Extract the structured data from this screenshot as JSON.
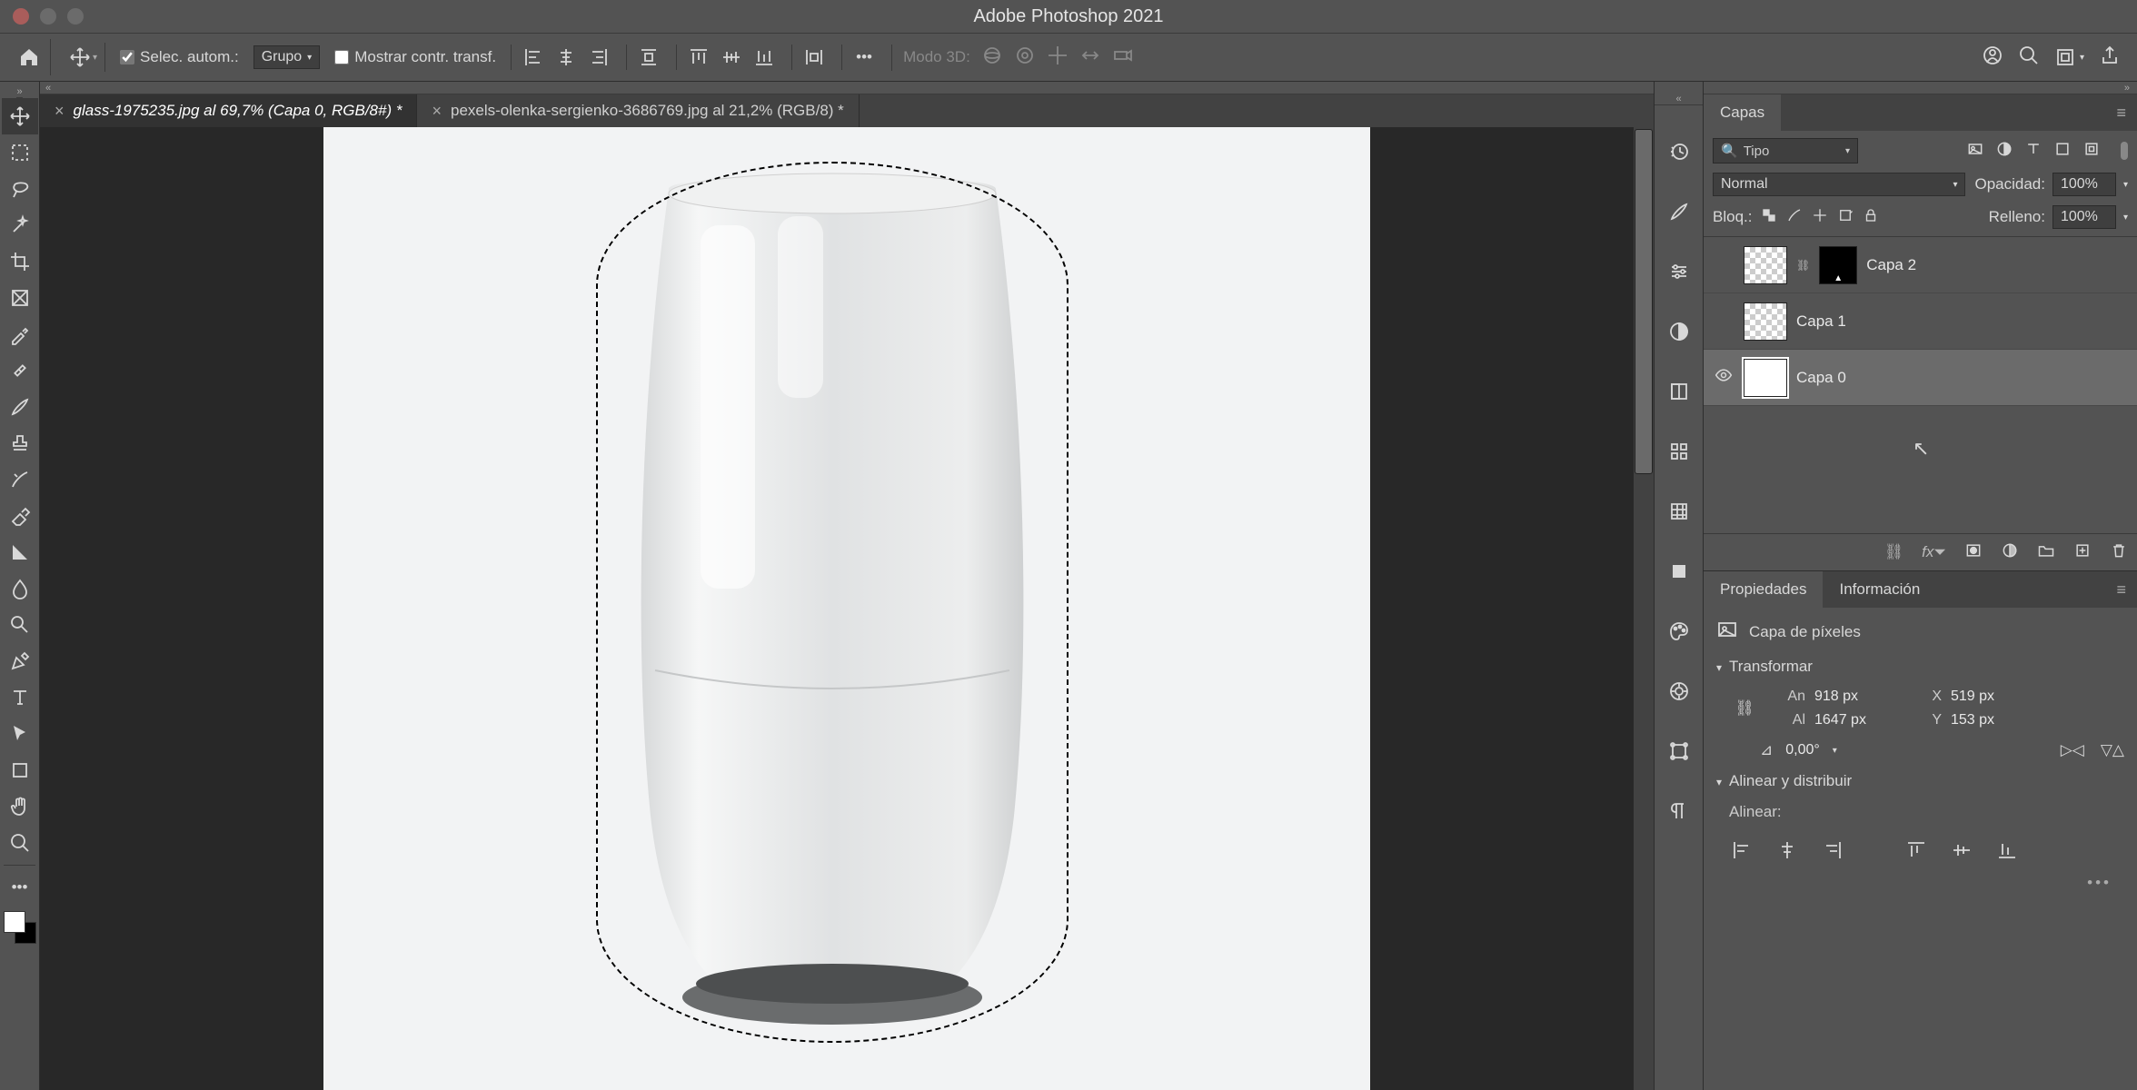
{
  "app_title": "Adobe Photoshop 2021",
  "options": {
    "auto_select_label": "Selec. autom.:",
    "group_select": "Grupo",
    "show_transform_label": "Mostrar contr. transf.",
    "mode3d_label": "Modo 3D:"
  },
  "tabs": [
    {
      "title": "glass-1975235.jpg al 69,7% (Capa 0, RGB/8#) *",
      "active": true
    },
    {
      "title": "pexels-olenka-sergienko-3686769.jpg al 21,2% (RGB/8) *",
      "active": false
    }
  ],
  "panels": {
    "layers_tab": "Capas",
    "filter_label": "Tipo",
    "blend_mode": "Normal",
    "opacity_label": "Opacidad:",
    "opacity_value": "100%",
    "lock_label": "Bloq.:",
    "fill_label": "Relleno:",
    "fill_value": "100%",
    "layers": [
      {
        "name": "Capa 2",
        "visible": false,
        "has_mask": true,
        "selected": false
      },
      {
        "name": "Capa 1",
        "visible": false,
        "has_mask": false,
        "selected": false
      },
      {
        "name": "Capa 0",
        "visible": true,
        "has_mask": false,
        "selected": true
      }
    ],
    "properties_tab": "Propiedades",
    "info_tab": "Información",
    "pixel_layer_label": "Capa de píxeles",
    "transform_label": "Transformar",
    "transform": {
      "w_label": "An",
      "w": "918 px",
      "h_label": "Al",
      "h": "1647 px",
      "x_label": "X",
      "x": "519 px",
      "y_label": "Y",
      "y": "153 px",
      "rot_label": "0,00°"
    },
    "align_label": "Alinear y distribuir",
    "align_sub": "Alinear:"
  }
}
